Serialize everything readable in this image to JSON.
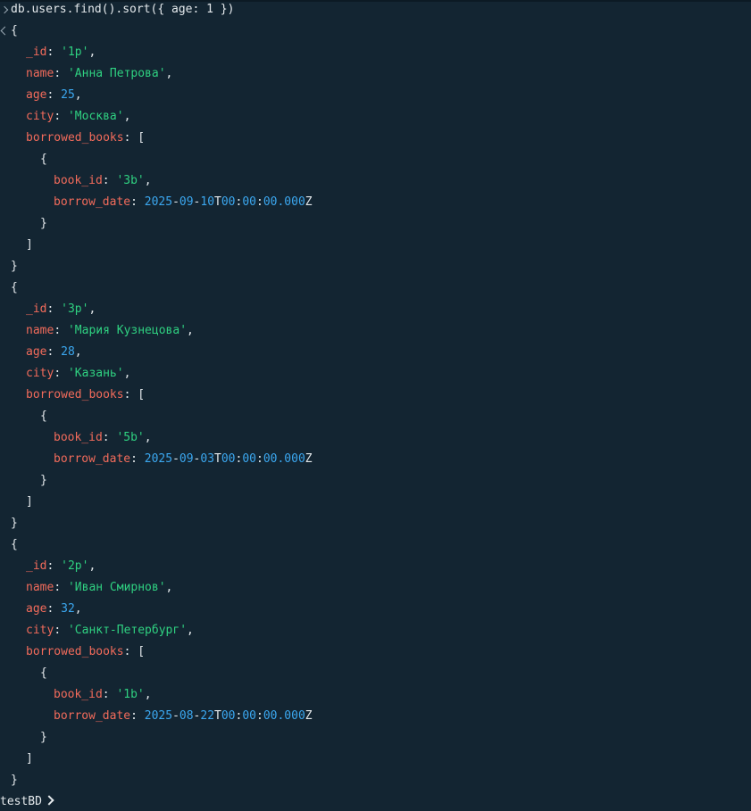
{
  "command": "db.users.find().sort({ age: 1 })",
  "prompt_db": "testBD",
  "colors": {
    "background": "#132532",
    "key": "#f26b5b",
    "string": "#2fd181",
    "number": "#3ba7ef",
    "punctuation": "#e4e9ec"
  },
  "icons": {
    "input_marker": "chevron-right-icon",
    "output_marker": "chevron-left-icon",
    "prompt_marker": "chevron-right-icon"
  },
  "documents": [
    {
      "_id": "'1p'",
      "name": "'Анна Петрова'",
      "age": "25",
      "city": "'Москва'",
      "book_id": "'3b'",
      "borrow_date": {
        "y": "2025",
        "m": "09",
        "d": "10",
        "hh": "00",
        "mm": "00",
        "ss": "00.000"
      }
    },
    {
      "_id": "'3p'",
      "name": "'Мария Кузнецова'",
      "age": "28",
      "city": "'Казань'",
      "book_id": "'5b'",
      "borrow_date": {
        "y": "2025",
        "m": "09",
        "d": "03",
        "hh": "00",
        "mm": "00",
        "ss": "00.000"
      }
    },
    {
      "_id": "'2p'",
      "name": "'Иван Смирнов'",
      "age": "32",
      "city": "'Санкт-Петербург'",
      "book_id": "'1b'",
      "borrow_date": {
        "y": "2025",
        "m": "08",
        "d": "22",
        "hh": "00",
        "mm": "00",
        "ss": "00.000"
      }
    }
  ],
  "labels": {
    "id_key": "_id",
    "name_key": "name",
    "age_key": "age",
    "city_key": "city",
    "books_key": "borrowed_books",
    "book_id_key": "book_id",
    "borrow_date_key": "borrow_date"
  }
}
